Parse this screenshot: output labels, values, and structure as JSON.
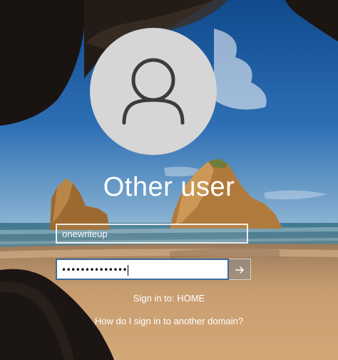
{
  "user": {
    "name": "Other user",
    "icon": "user-icon"
  },
  "login_form": {
    "username_value": "onewriteup",
    "password_masked": "••••••••••••••",
    "submit_icon": "arrow-right-icon"
  },
  "sign_in_to": "Sign in to: HOME",
  "other_domain_link": "How do I sign in to another domain?",
  "colors": {
    "sky": "#2e6fb4",
    "sea": "#3f7893",
    "sand": "#c89d70",
    "rock": "#b07a3c",
    "cave": "#191412",
    "avatar_circle": "#d6d6d6",
    "avatar_glyph": "#3c3c3c",
    "password_border": "#3d6a98"
  }
}
